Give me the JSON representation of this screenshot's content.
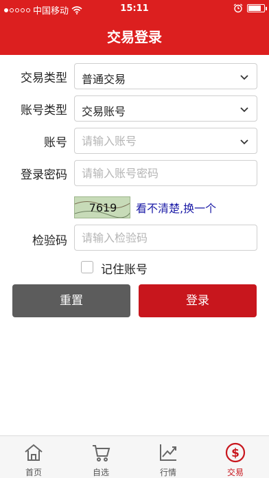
{
  "status_bar": {
    "carrier": "中国移动",
    "time": "15:11",
    "battery_level": 0.8
  },
  "header": {
    "title": "交易登录"
  },
  "form": {
    "trade_type": {
      "label": "交易类型",
      "value": "普通交易"
    },
    "account_type": {
      "label": "账号类型",
      "value": "交易账号"
    },
    "account": {
      "label": "账号",
      "placeholder": "请输入账号"
    },
    "password": {
      "label": "登录密码",
      "placeholder": "请输入账号密码"
    },
    "captcha": {
      "code": "7619",
      "refresh_label": "看不清楚,换一个"
    },
    "verify_code": {
      "label": "检验码",
      "placeholder": "请输入检验码"
    },
    "remember": {
      "label": "记住账号",
      "checked": false
    },
    "reset_label": "重置",
    "login_label": "登录"
  },
  "tabs": [
    {
      "label": "首页",
      "icon": "home-icon"
    },
    {
      "label": "自选",
      "icon": "cart-icon"
    },
    {
      "label": "行情",
      "icon": "chart-icon"
    },
    {
      "label": "交易",
      "icon": "dollar-icon",
      "active": true
    }
  ],
  "colors": {
    "primary": "#dc1f1f",
    "login_button": "#c8161d",
    "reset_button": "#5c5c5c",
    "link": "#1a1aa6"
  }
}
